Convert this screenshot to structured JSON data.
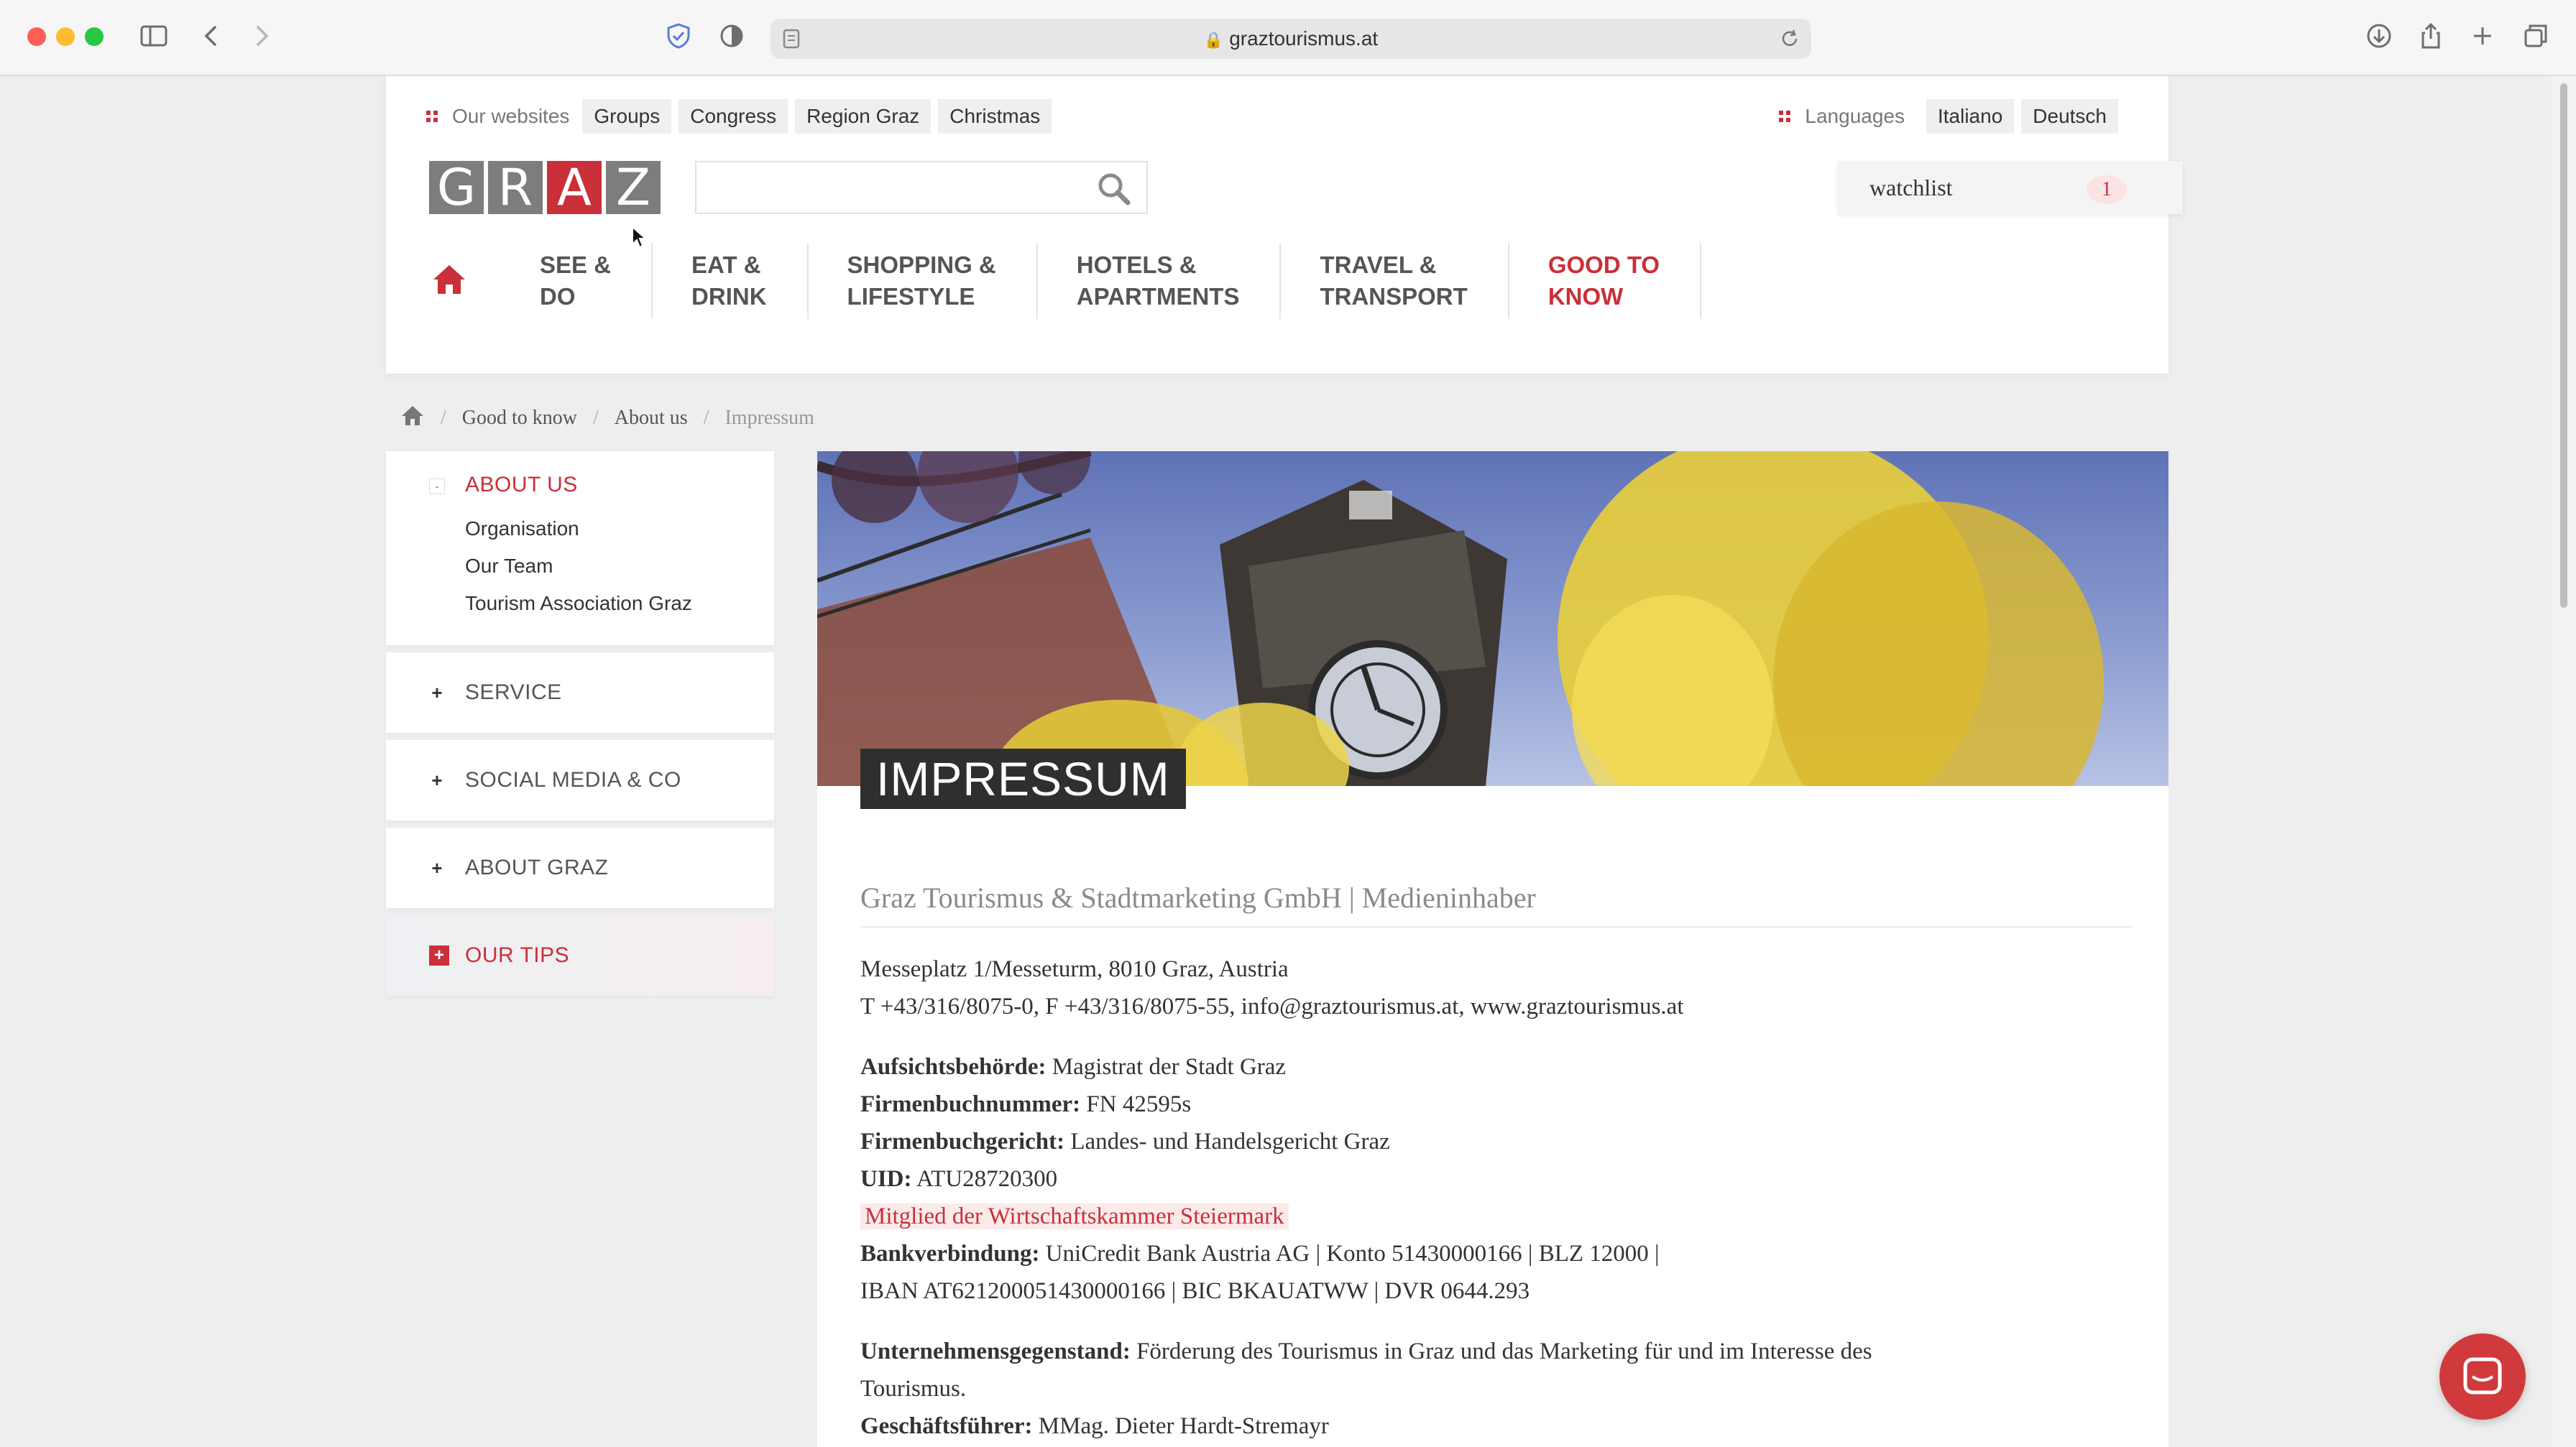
{
  "browser": {
    "url": "graztourismus.at"
  },
  "topbar": {
    "websites_label": "Our websites",
    "websites": [
      "Groups",
      "Congress",
      "Region Graz",
      "Christmas"
    ],
    "languages_label": "Languages",
    "languages": [
      "Italiano",
      "Deutsch"
    ]
  },
  "logo": {
    "letters": [
      "G",
      "R",
      "A",
      "Z"
    ]
  },
  "search": {
    "placeholder": "",
    "value": ""
  },
  "watchlist": {
    "label": "watchlist",
    "count": "1"
  },
  "nav": {
    "items": [
      {
        "label": "SEE &\nDO",
        "active": false
      },
      {
        "label": "EAT &\nDRINK",
        "active": false
      },
      {
        "label": "SHOPPING &\nLIFESTYLE",
        "active": false
      },
      {
        "label": "HOTELS &\nAPARTMENTS",
        "active": false
      },
      {
        "label": "TRAVEL &\nTRANSPORT",
        "active": false
      },
      {
        "label": "GOOD TO\nKNOW",
        "active": true
      }
    ]
  },
  "breadcrumb": {
    "items": [
      "Good to know",
      "About us"
    ],
    "current": "Impressum"
  },
  "sidebar": {
    "open_title": "ABOUT US",
    "open_items": [
      "Organisation",
      "Our Team",
      "Tourism Association Graz"
    ],
    "sections": [
      "SERVICE",
      "SOCIAL MEDIA & CO",
      "ABOUT GRAZ"
    ],
    "tips": "OUR TIPS"
  },
  "content": {
    "hero_title": "IMPRESSUM",
    "company": "Graz Tourismus & Stadtmarketing GmbH | Medieninhaber",
    "address": "Messeplatz 1/Messeturm, 8010 Graz, Austria",
    "contact": "T +43/316/8075-0, F +43/316/8075-55, info@graztourismus.at, www.graztourismus.at",
    "authority_label": "Aufsichtsbehörde:",
    "authority_value": "Magistrat der Stadt Graz",
    "register_no_label": "Firmenbuchnummer:",
    "register_no_value": "FN 42595s",
    "court_label": "Firmenbuchgericht:",
    "court_value": "Landes- und Handelsgericht Graz",
    "uid_label": "UID:",
    "uid_value": "ATU28720300",
    "member_link": "Mitglied der Wirtschaftskammer Steiermark",
    "bank_label": "Bankverbindung:",
    "bank_value_1": "UniCredit Bank Austria AG | Konto 51430000166 | BLZ 12000 |",
    "bank_value_2": "IBAN AT621200051430000166 | BIC BKAUATWW | DVR 0644.293",
    "purpose_label": "Unternehmensgegenstand:",
    "purpose_value_1": "Förderung des Tourismus in Graz und das Marketing für und im Interesse des",
    "purpose_value_2": "Tourismus.",
    "ceo_label": "Geschäftsführer:",
    "ceo_value": "MMag. Dieter Hardt-Stremayr"
  },
  "colors": {
    "brand_red": "#c9303a",
    "logo_grey": "#7d7d7d"
  }
}
